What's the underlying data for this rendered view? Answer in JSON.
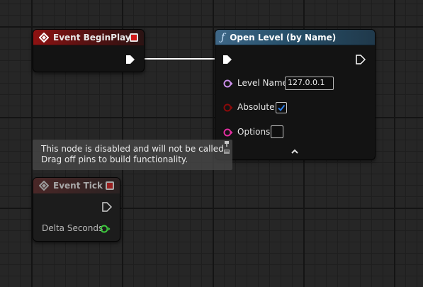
{
  "colors": {
    "event_header": "#8e1212",
    "function_header": "#3e6787",
    "exec_pin": "#ffffff",
    "name_pin": "#c98ee8",
    "bool_pin": "#8a0a0a",
    "string_pin": "#e32ea0",
    "float_pin": "#3cc83c",
    "checkbox_accent": "#1a6ed8"
  },
  "nodes": {
    "event_begin_play": {
      "title": "Event BeginPlay",
      "icon": "event-diamond-icon"
    },
    "open_level": {
      "title": "Open Level (by Name)",
      "icon": "function-icon",
      "inputs": {
        "level_name": {
          "label": "Level Name",
          "value": "127.0.0.1"
        },
        "absolute": {
          "label": "Absolute",
          "checked": true
        },
        "options": {
          "label": "Options",
          "checked": false
        }
      },
      "expand_icon": "chevron-up-icon"
    },
    "event_tick": {
      "title": "Event Tick",
      "icon": "event-diamond-icon",
      "disabled": true,
      "outputs": {
        "delta_seconds": {
          "label": "Delta Seconds"
        }
      }
    }
  },
  "tooltip": {
    "line1": "This node is disabled and will not be called.",
    "line2": "Drag off pins to build functionality."
  }
}
